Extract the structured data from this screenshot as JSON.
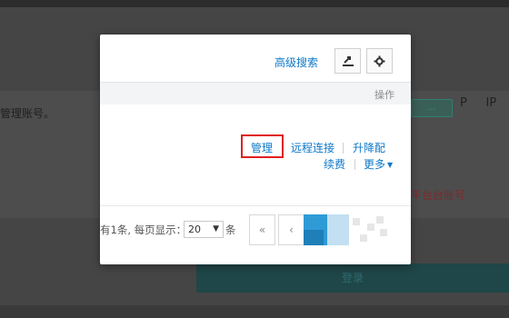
{
  "background": {
    "left_text": "管理账号。",
    "right_text": "P     IP",
    "chip_label": "…",
    "red_text": "平台台账号",
    "button_label": "登录"
  },
  "modal": {
    "toolbar": {
      "advanced_search_label": "高级搜索",
      "export_icon": "export-icon",
      "settings_icon": "gear-icon"
    },
    "table": {
      "ops_header": "操作",
      "actions": {
        "manage": "管理",
        "remote_connect": "远程连接",
        "scale": "升降配",
        "renew": "续费",
        "more": "更多"
      }
    },
    "pagination": {
      "summary_text": "有1条, 每页显示：",
      "page_size": "20",
      "unit": "条",
      "first": "«",
      "prev": "‹"
    }
  },
  "colors": {
    "link": "#0e78c8",
    "highlight": "#e02020"
  }
}
